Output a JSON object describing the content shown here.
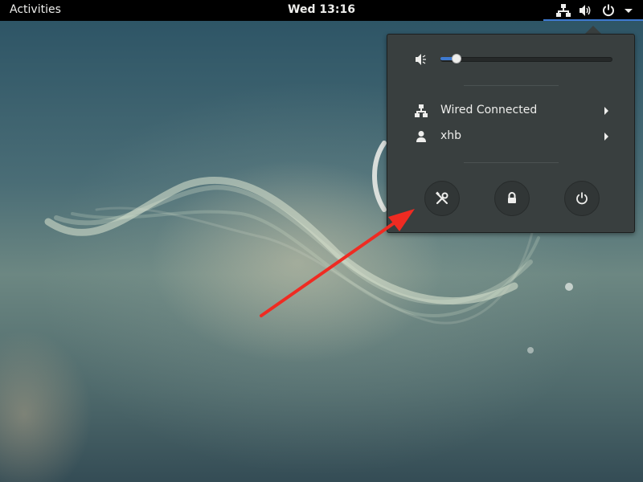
{
  "topbar": {
    "activities_label": "Activities",
    "clock": "Wed 13:16",
    "status_icons": [
      "network-wired-icon",
      "speaker-volume-icon",
      "power-icon",
      "dropdown-arrow-icon"
    ]
  },
  "system_menu": {
    "volume": {
      "icon": "speaker-low-icon",
      "level": 0.07
    },
    "items": [
      {
        "icon": "network-wired-icon",
        "label": "Wired Connected"
      },
      {
        "icon": "user-icon",
        "label": "xhb"
      }
    ],
    "buttons": [
      {
        "name": "settings-button",
        "icon": "tools-icon"
      },
      {
        "name": "lock-button",
        "icon": "lock-icon"
      },
      {
        "name": "power-off-button",
        "icon": "power-icon"
      }
    ]
  },
  "colors": {
    "accent": "#3e7ad1",
    "menu_bg": "#393f3f",
    "topbar_bg": "#000000",
    "annotation_arrow": "#ef2b22"
  }
}
